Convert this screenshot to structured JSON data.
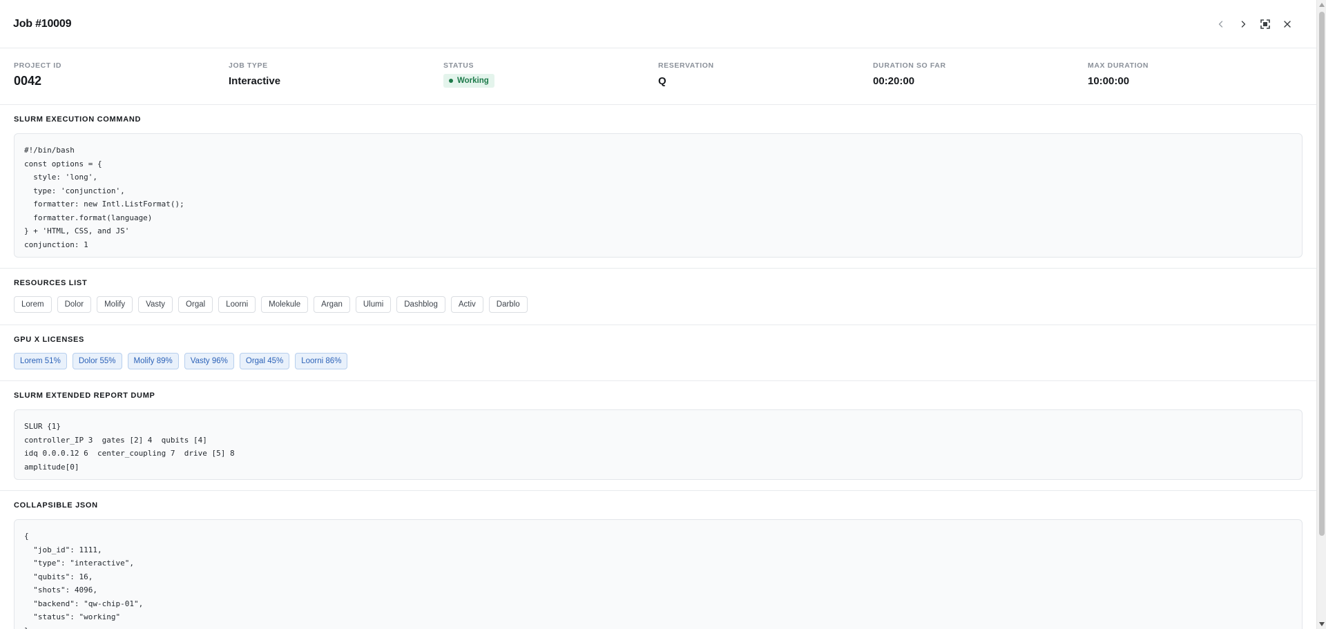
{
  "header": {
    "title": "Job #10009",
    "icons": [
      "chevron-left-icon",
      "chevron-right-icon",
      "expand-icon",
      "close-icon"
    ]
  },
  "meta": {
    "project_id": {
      "label": "PROJECT ID",
      "value": "0042"
    },
    "job_type": {
      "label": "JOB TYPE",
      "value": "Interactive"
    },
    "status": {
      "label": "STATUS",
      "value": "Working",
      "color": "#1d7a4a",
      "bg": "#e4f4ec"
    },
    "reservation": {
      "label": "RESERVATION",
      "value": "Q"
    },
    "duration": {
      "label": "DURATION SO FAR",
      "value": "00:20:00"
    },
    "max_duration": {
      "label": "MAX DURATION",
      "value": "10:00:00"
    }
  },
  "slurm_command": {
    "title": "SLURM EXECUTION COMMAND",
    "code": "#!/bin/bash\nconst options = {\n  style: 'long',\n  type: 'conjunction',\n  formatter: new Intl.ListFormat();\n  formatter.format(language)\n} + 'HTML, CSS, and JS'\nconjunction: 1"
  },
  "resources": {
    "title": "RESOURCES LIST",
    "items": [
      "Lorem",
      "Dolor",
      "Molify",
      "Vasty",
      "Orgal",
      "Loorni",
      "Molekule",
      "Argan",
      "Ulumi",
      "Dashblog",
      "Activ",
      "Darblo"
    ]
  },
  "gpu": {
    "title": "GPU X LICENSES",
    "items": [
      "Lorem 51%",
      "Dolor 55%",
      "Molify 89%",
      "Vasty 96%",
      "Orgal 45%",
      "Loorni 86%"
    ]
  },
  "report_dump": {
    "title": "SLURM EXTENDED REPORT DUMP",
    "code": "SLUR {1}\ncontroller_IP 3  gates [2] 4  qubits [4]\nidq 0.0.0.12 6  center_coupling 7  drive [5] 8\namplitude[0]"
  },
  "json": {
    "title": "COLLAPSIBLE JSON",
    "code": "{\n  \"job_id\": 1111,\n  \"type\": \"interactive\",\n  \"qubits\": 16,\n  \"shots\": 4096,\n  \"backend\": \"qw-chip-01\",\n  \"status\": \"working\"\n}"
  }
}
